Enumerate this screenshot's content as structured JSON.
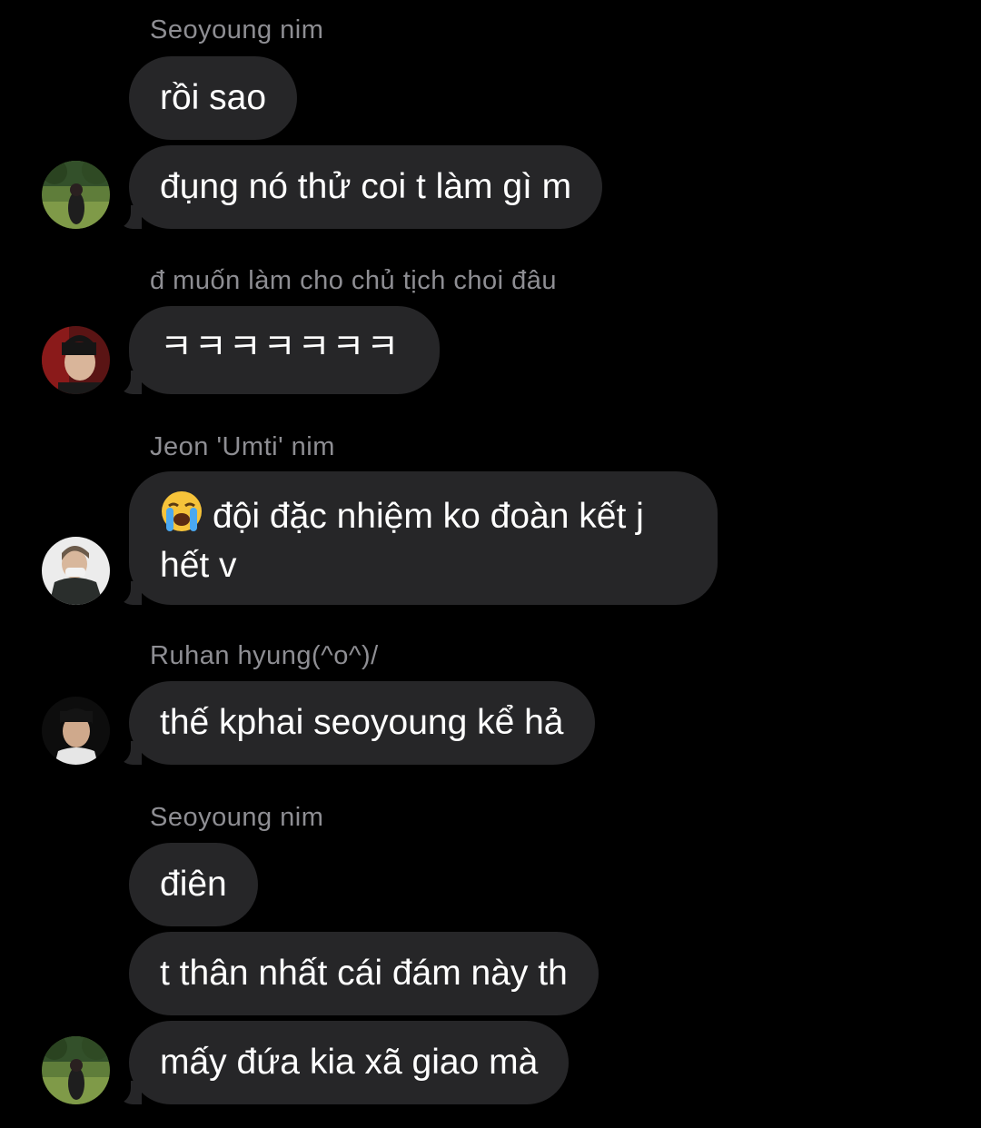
{
  "messages": [
    {
      "sender": "Seoyoung nim",
      "bubbles": [
        "rồi sao",
        "đụng nó thử coi t làm gì m"
      ],
      "avatar": "seoyoung-avatar"
    },
    {
      "sender": "đ muốn làm cho chủ tịch choi đâu",
      "bubbles": [
        "ㅋㅋㅋㅋㅋㅋㅋ"
      ],
      "avatar": "user2-avatar"
    },
    {
      "sender": "Jeon 'Umti' nim",
      "bubbles": [
        "đội đặc nhiệm ko đoàn kết j hết v"
      ],
      "emoji": "loudly-crying-face",
      "avatar": "umti-avatar"
    },
    {
      "sender": "Ruhan hyung(^o^)/",
      "bubbles": [
        "thế kphai seoyoung kể hả"
      ],
      "avatar": "ruhan-avatar"
    },
    {
      "sender": "Seoyoung nim",
      "bubbles": [
        "điên",
        "t thân nhất cái đám này th",
        "mấy đứa kia xã giao mà"
      ],
      "avatar": "seoyoung-avatar"
    }
  ],
  "colors": {
    "background": "#000000",
    "bubble": "#262628",
    "sender_text": "#8e8e93",
    "message_text": "#ffffff"
  }
}
